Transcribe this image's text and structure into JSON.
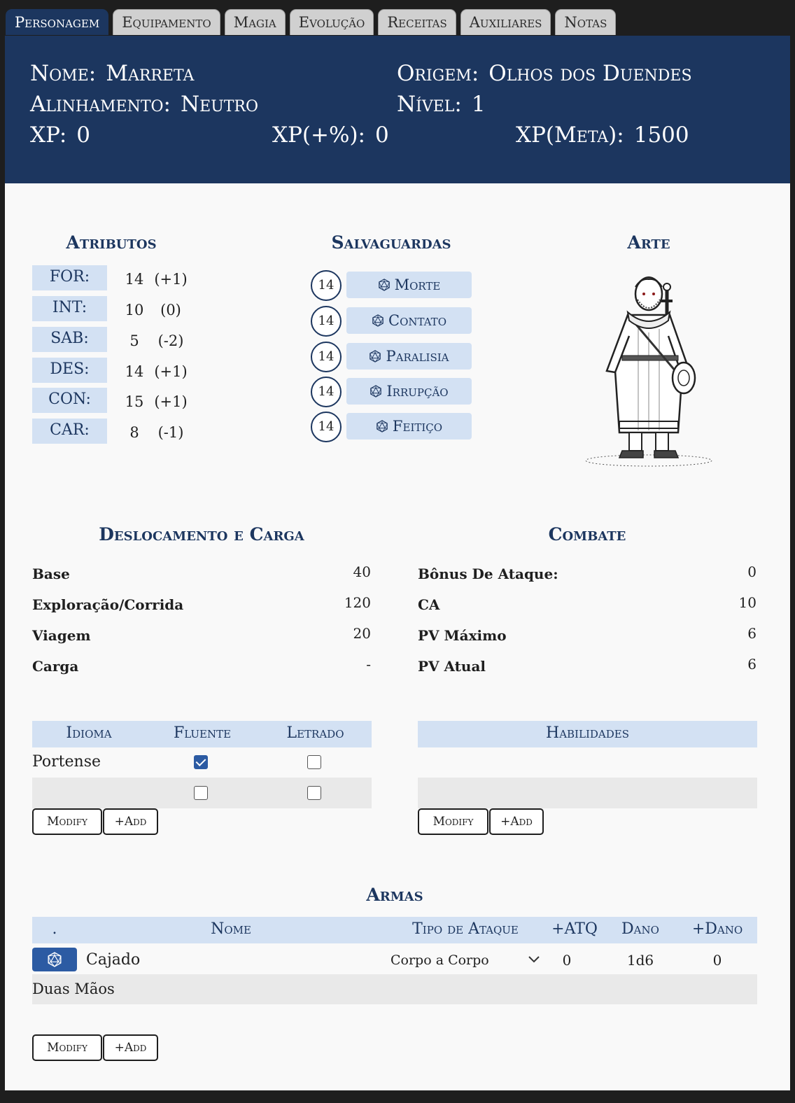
{
  "tabs": [
    "Personagem",
    "Equipamento",
    "Magia",
    "Evolução",
    "Receitas",
    "Auxiliares",
    "Notas"
  ],
  "header": {
    "nome_label": "Nome:",
    "nome": "Marreta",
    "origem_label": "Origem:",
    "origem": "Olhos dos Duendes",
    "alinhamento_label": "Alinhamento:",
    "alinhamento": "Neutro",
    "nivel_label": "Nível:",
    "nivel": "1",
    "xp_label": "XP:",
    "xp": "0",
    "xp_bonus_label": "XP(+%):",
    "xp_bonus": "0",
    "xp_meta_label": "XP(Meta):",
    "xp_meta": "1500"
  },
  "atributos": {
    "title": "Atributos",
    "rows": [
      {
        "label": "FOR:",
        "value": "14",
        "mod": "(+1)"
      },
      {
        "label": "INT:",
        "value": "10",
        "mod": "(0)"
      },
      {
        "label": "SAB:",
        "value": "5",
        "mod": "(-2)"
      },
      {
        "label": "DES:",
        "value": "14",
        "mod": "(+1)"
      },
      {
        "label": "CON:",
        "value": "15",
        "mod": "(+1)"
      },
      {
        "label": "CAR:",
        "value": "8",
        "mod": "(-1)"
      }
    ]
  },
  "salvaguardas": {
    "title": "Salvaguardas",
    "icon": "d20-icon",
    "rows": [
      {
        "value": "14",
        "label": "Morte"
      },
      {
        "value": "14",
        "label": "Contato"
      },
      {
        "value": "14",
        "label": "Paralisia"
      },
      {
        "value": "14",
        "label": "Irrupção"
      },
      {
        "value": "14",
        "label": "Feitiço"
      }
    ]
  },
  "arte": {
    "title": "Arte"
  },
  "deslocamento": {
    "title": "Deslocamento e Carga",
    "rows": [
      {
        "label": "Base",
        "value": "40"
      },
      {
        "label": "Exploração/Corrida",
        "value": "120"
      },
      {
        "label": "Viagem",
        "value": "20"
      },
      {
        "label": "Carga",
        "value": "-"
      }
    ]
  },
  "combate": {
    "title": "Combate",
    "rows": [
      {
        "label": "Bônus De Ataque:",
        "value": "0"
      },
      {
        "label": "CA",
        "value": "10"
      },
      {
        "label": "PV Máximo",
        "value": "6"
      },
      {
        "label": "PV Atual",
        "value": "6"
      }
    ]
  },
  "idiomas": {
    "headers": [
      "Idioma",
      "Fluente",
      "Letrado"
    ],
    "rows": [
      {
        "idioma": "Portense",
        "fluente": true,
        "letrado": false
      },
      {
        "idioma": "",
        "fluente": false,
        "letrado": false
      }
    ],
    "modify_label": "Modify",
    "add_label": "+Add"
  },
  "habilidades": {
    "header": "Habilidades",
    "modify_label": "Modify",
    "add_label": "+Add"
  },
  "armas": {
    "title": "Armas",
    "headers": [
      ".",
      "Nome",
      "Tipo de Ataque",
      "+ATQ",
      "Dano",
      "+Dano"
    ],
    "rows": [
      {
        "nome": "Cajado",
        "tipo": "Corpo a Corpo",
        "atq": "0",
        "dano": "1d6",
        "bonus_dano": "0",
        "propriedades": "Duas Mãos"
      }
    ],
    "modify_label": "Modify",
    "add_label": "+Add"
  },
  "colors": {
    "primary": "#1c365f",
    "light_blue": "#d3e1f3",
    "checkbox_checked": "#2c5ba3",
    "sheet_bg": "#f9f9f9",
    "row_grey": "#e9e9e9"
  }
}
